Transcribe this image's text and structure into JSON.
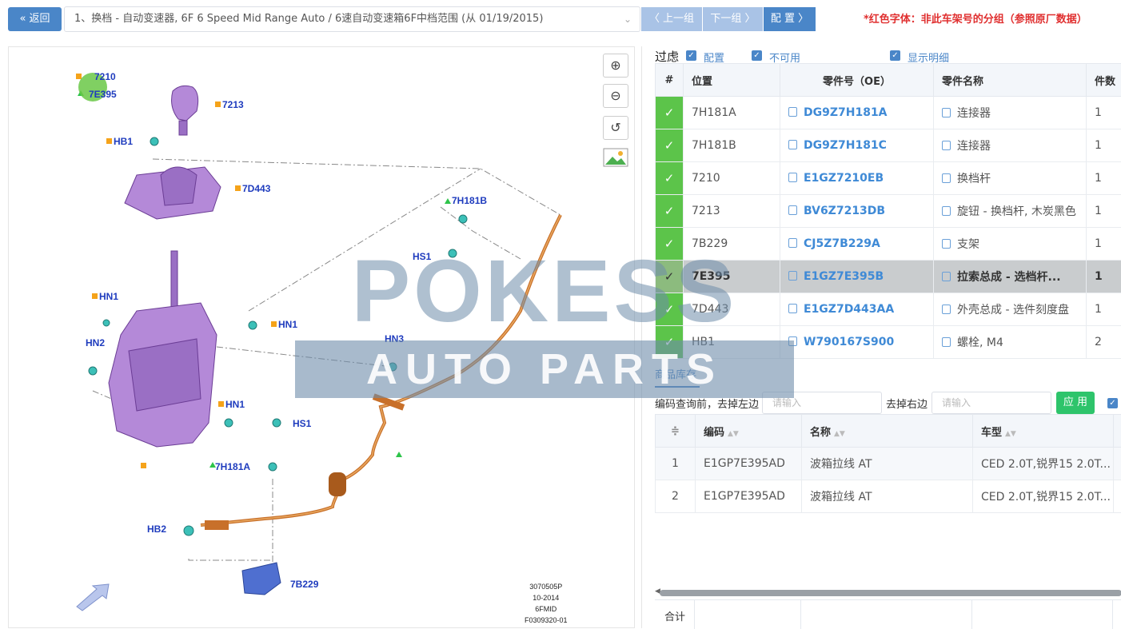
{
  "topbar": {
    "back_label": "« 返回",
    "selector_value": "1、换档 - 自动变速器, 6F 6 Speed Mid Range Auto / 6速自动变速箱6F中档范围 (从 01/19/2015)",
    "prev_label": "〈  上一组",
    "next_label": "下一组  〉",
    "config_label": "配 置  〉",
    "red_note": "*红色字体：非此车架号的分组（参照原厂数据）"
  },
  "diagram": {
    "labels": [
      "7210",
      "7E395",
      "7213",
      "HB1",
      "7D443",
      "7H181B",
      "HS1",
      "HN1",
      "HN1",
      "HN2",
      "HN3",
      "HN1",
      "HS1",
      "7H181A",
      "HB2",
      "7B229"
    ],
    "footer_code": [
      "3070505P",
      "10-2014",
      "6FMID",
      "F0309320-01"
    ]
  },
  "watermark": {
    "line1": "POKESS",
    "line2": "AUTO PARTS"
  },
  "filter": {
    "title": "过虑",
    "options": [
      "配置",
      "不可用",
      "显示明细"
    ]
  },
  "parts_table": {
    "headers": [
      "#",
      "位置",
      "零件号（OE）",
      "零件名称",
      "件数"
    ],
    "rows": [
      {
        "check": "✓",
        "position": "7H181A",
        "oe": "DG9Z7H181A",
        "name": "连接器",
        "qty": "1"
      },
      {
        "check": "✓",
        "position": "7H181B",
        "oe": "DG9Z7H181C",
        "name": "连接器",
        "qty": "1"
      },
      {
        "check": "✓",
        "position": "7210",
        "oe": "E1GZ7210EB",
        "name": "换档杆",
        "qty": "1"
      },
      {
        "check": "✓",
        "position": "7213",
        "oe": "BV6Z7213DB",
        "name": "旋钮 - 换档杆, 木炭黑色",
        "qty": "1"
      },
      {
        "check": "✓",
        "position": "7B229",
        "oe": "CJ5Z7B229A",
        "name": "支架",
        "qty": "1"
      },
      {
        "check": "✓",
        "position": "7E395",
        "oe": "E1GZ7E395B",
        "name": "拉索总成 - 选档杆...",
        "qty": "1"
      },
      {
        "check": "✓",
        "position": "7D443",
        "oe": "E1GZ7D443AA",
        "name": "外壳总成 - 选件刻度盘",
        "qty": "1"
      },
      {
        "check": "✓",
        "position": "HB1",
        "oe": "W790167S900",
        "name": "螺栓, M4",
        "qty": "2"
      }
    ]
  },
  "stock": {
    "tab_label": "商品库存",
    "left_label": "编码查询前，去掉左边",
    "left_placeholder": "请输入",
    "right_label": "去掉右边",
    "right_placeholder": "请输入",
    "apply_label": "应 用",
    "headers": [
      "编码",
      "名称",
      "车型"
    ],
    "rows": [
      {
        "idx": "1",
        "code": "E1GP7E395AD",
        "name": "波箱拉线 AT",
        "model": "CED 2.0T,锐界15 2.0T..."
      },
      {
        "idx": "2",
        "code": "E1GP7E395AD",
        "name": "波箱拉线 AT",
        "model": "CED 2.0T,锐界15 2.0T..."
      }
    ],
    "total_label": "合计"
  },
  "colors": {
    "accent": "#4a86c8",
    "check_green": "#5cc44a",
    "apply_green": "#2ec46b",
    "red": "#e03030",
    "label_blue": "#1f3cbe"
  }
}
